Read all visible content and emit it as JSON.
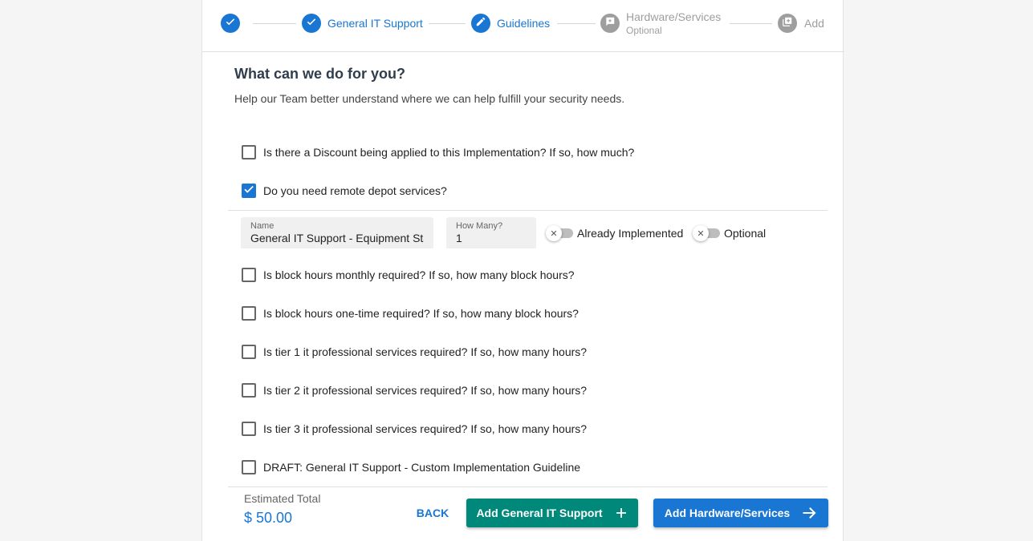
{
  "stepper": {
    "steps": [
      {
        "label": "",
        "state": "complete",
        "icon": "check-icon"
      },
      {
        "label": "General IT Support",
        "state": "complete",
        "icon": "check-icon"
      },
      {
        "label": "Guidelines",
        "state": "active",
        "icon": "pencil-icon"
      },
      {
        "label": "Hardware/Services",
        "sublabel": "Optional",
        "state": "pending",
        "icon": "comment-plus-icon"
      },
      {
        "label": "Add",
        "state": "pending",
        "icon": "library-add-icon"
      }
    ]
  },
  "section": {
    "title": "What can we do for you?",
    "description": "Help our Team better understand where we can help fulfill your security needs."
  },
  "questions": [
    {
      "label": "Is there a Discount being applied to this Implementation? If so, how much?",
      "checked": false
    },
    {
      "label": "Do you need remote depot services?",
      "checked": true
    },
    {
      "label": "Is block hours monthly required? If so, how many block hours?",
      "checked": false
    },
    {
      "label": "Is block hours one-time required? If so, how many block hours?",
      "checked": false
    },
    {
      "label": "Is tier 1 it professional services required? If so, how many hours?",
      "checked": false
    },
    {
      "label": "Is tier 2 it professional services required? If so, how many hours?",
      "checked": false
    },
    {
      "label": "Is tier 3 it professional services required? If so, how many hours?",
      "checked": false
    },
    {
      "label": "DRAFT: General IT Support - Custom Implementation Guideline",
      "checked": false
    }
  ],
  "depot_item": {
    "name_label": "Name",
    "name_value": "General IT Support - Equipment Staging",
    "qty_label": "How Many?",
    "qty_value": "1",
    "already_implemented_label": "Already Implemented",
    "already_implemented": false,
    "optional_label": "Optional",
    "optional": false
  },
  "footer": {
    "total_label": "Estimated Total",
    "total_value": "$ 50.00",
    "back_label": "BACK",
    "add_support_label": "Add General IT Support",
    "add_hardware_label": "Add Hardware/Services"
  },
  "colors": {
    "primary": "#1976d2",
    "secondary": "#00897b",
    "inactive": "#9e9e9e"
  }
}
